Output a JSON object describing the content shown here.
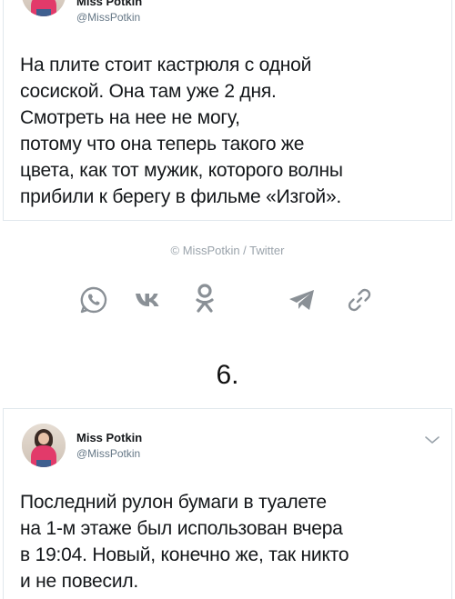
{
  "tweet1": {
    "name": "Miss Potkin",
    "handle": "@MissPotkin",
    "text": "На плите стоит кастрюля с одной\nсосиской. Она там уже 2 дня.\nСмотреть на нее не могу,\nпотому что она теперь такого же\nцвета, как тот мужик, которого волны\nприбили к берегу в фильме «Изгой»."
  },
  "credit": "© MissPotkin / Twitter",
  "share": {
    "icons": [
      "whatsapp-icon",
      "vk-icon",
      "odnoklassniki-icon",
      "telegram-icon",
      "link-icon"
    ],
    "color": "#8a9096"
  },
  "number": "6.",
  "tweet2": {
    "name": "Miss Potkin",
    "handle": "@MissPotkin",
    "text": "Последний рулон бумаги в туалете\nна 1-м этаже был использован вчера\nв 19:04. Новый, конечно же, так никто\nи не повесил."
  }
}
